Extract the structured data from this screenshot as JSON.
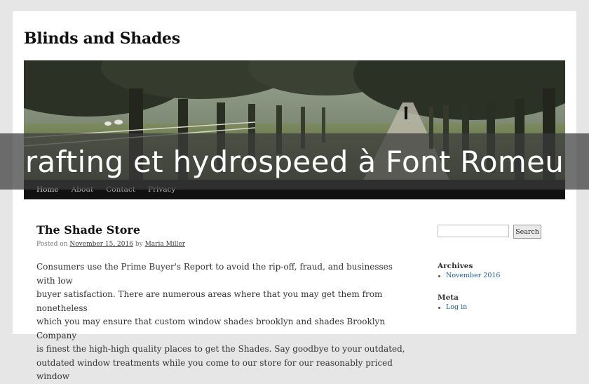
{
  "site": {
    "title": "Blinds and Shades"
  },
  "menu": {
    "items": [
      "Home",
      "About",
      "Contact",
      "Privacy"
    ]
  },
  "overlay": {
    "text": "rafting et hydrospeed à Font Romeu"
  },
  "post": {
    "title": "The Shade Store",
    "posted_on_label": "Posted on",
    "date": "November 15, 2016",
    "by_label": "by",
    "author": "Maria Miller",
    "body_lines": [
      "Consumers use the Prime Buyer's Report to avoid the rip-off, fraud, and businesses with low",
      "buyer satisfaction. There are numerous areas where that you may get them from nonetheless",
      "which you may ensure that custom window shades brooklyn and shades Brooklyn Company",
      "is finest the high-high quality places to get the Shades. Say goodbye to your outdated,",
      "outdated window treatments while you come to our store for our reasonably priced window"
    ]
  },
  "sidebar": {
    "search_placeholder": "",
    "search_button": "Search",
    "archives_title": "Archives",
    "archives_items": [
      "November 2016"
    ],
    "meta_title": "Meta",
    "meta_items": [
      "Log in"
    ]
  }
}
